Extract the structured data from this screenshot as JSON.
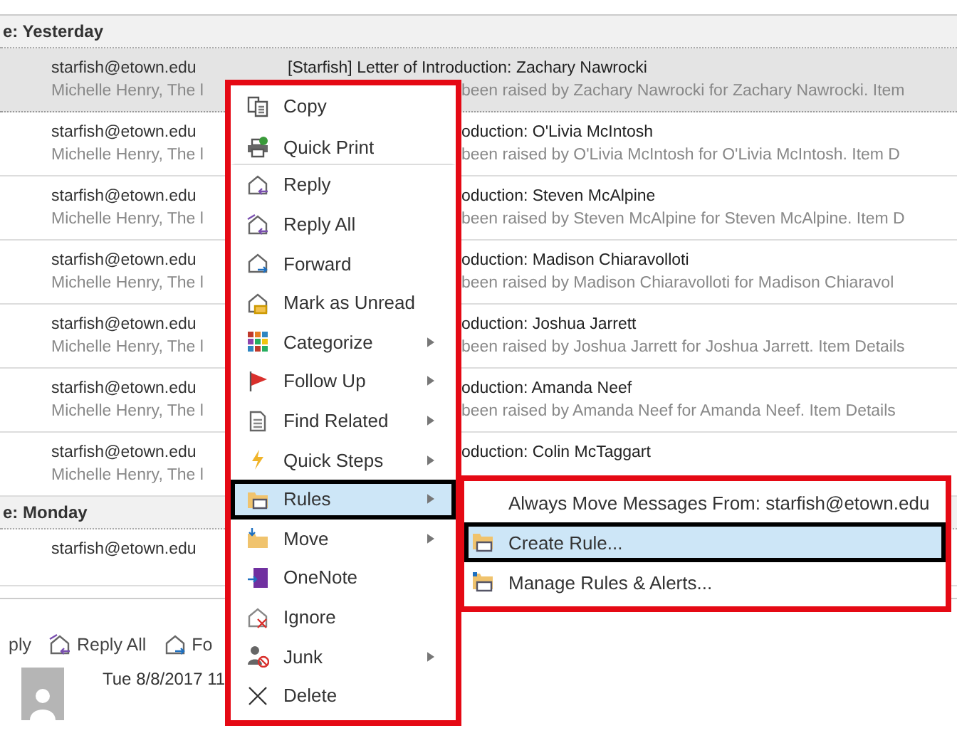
{
  "groups": [
    {
      "label": "e: Yesterday",
      "rows": [
        {
          "sender": "starfish@etown.edu",
          "subject": "[Starfish] Letter of Introduction: Zachary Nawrocki",
          "preview_start": "Michelle Henry, The l",
          "preview_end": "been raised by Zachary Nawrocki for Zachary Nawrocki. Item",
          "selected": true
        },
        {
          "sender": "starfish@etown.edu",
          "subject": "oduction: O'Livia McIntosh",
          "preview_start": "Michelle Henry, The l",
          "preview_end": "been raised by O'Livia McIntosh for O'Livia McIntosh. Item D",
          "selected": false
        },
        {
          "sender": "starfish@etown.edu",
          "subject": "oduction: Steven McAlpine",
          "preview_start": "Michelle Henry, The l",
          "preview_end": "been raised by Steven McAlpine for Steven McAlpine. Item D",
          "selected": false
        },
        {
          "sender": "starfish@etown.edu",
          "subject": "oduction: Madison Chiaravolloti",
          "preview_start": "Michelle Henry, The l",
          "preview_end": "been raised by Madison Chiaravolloti for Madison Chiaravol",
          "selected": false
        },
        {
          "sender": "starfish@etown.edu",
          "subject": "oduction: Joshua Jarrett",
          "preview_start": "Michelle Henry, The l",
          "preview_end": "been raised by Joshua Jarrett for Joshua Jarrett. Item Details",
          "selected": false
        },
        {
          "sender": "starfish@etown.edu",
          "subject": "oduction: Amanda Neef",
          "preview_start": "Michelle Henry, The l",
          "preview_end": "been raised by Amanda Neef for Amanda Neef. Item Details",
          "selected": false
        },
        {
          "sender": "starfish@etown.edu",
          "subject": "oduction: Colin McTaggart",
          "preview_start": "Michelle Henry, The l",
          "selected": false
        }
      ]
    },
    {
      "label": "e: Monday",
      "rows": [
        {
          "sender": "starfish@etown.edu",
          "selected": false
        }
      ]
    }
  ],
  "reading_pane": {
    "toolbar": [
      "ply",
      "Reply All",
      "Fo"
    ],
    "date": "Tue 8/8/2017 11"
  },
  "context_menu": {
    "items": [
      {
        "label": "Copy",
        "submenu": false,
        "selected": false
      },
      {
        "label": "Quick Print",
        "submenu": false,
        "selected": false
      },
      {
        "label": "Reply",
        "submenu": false,
        "selected": false
      },
      {
        "label": "Reply All",
        "submenu": false,
        "selected": false
      },
      {
        "label": "Forward",
        "submenu": false,
        "selected": false
      },
      {
        "label": "Mark as Unread",
        "submenu": false,
        "selected": false
      },
      {
        "label": "Categorize",
        "submenu": true,
        "selected": false
      },
      {
        "label": "Follow Up",
        "submenu": true,
        "selected": false
      },
      {
        "label": "Find Related",
        "submenu": true,
        "selected": false
      },
      {
        "label": "Quick Steps",
        "submenu": true,
        "selected": false
      },
      {
        "label": "Rules",
        "submenu": true,
        "selected": true
      },
      {
        "label": "Move",
        "submenu": true,
        "selected": false
      },
      {
        "label": "OneNote",
        "submenu": false,
        "selected": false
      },
      {
        "label": "Ignore",
        "submenu": false,
        "selected": false
      },
      {
        "label": "Junk",
        "submenu": true,
        "selected": false
      },
      {
        "label": "Delete",
        "submenu": false,
        "selected": false
      }
    ]
  },
  "submenu": {
    "items": [
      {
        "label": "Always Move Messages From: starfish@etown.edu",
        "selected": false
      },
      {
        "label": "Create Rule...",
        "selected": true
      },
      {
        "label": "Manage Rules & Alerts...",
        "selected": false
      }
    ]
  }
}
